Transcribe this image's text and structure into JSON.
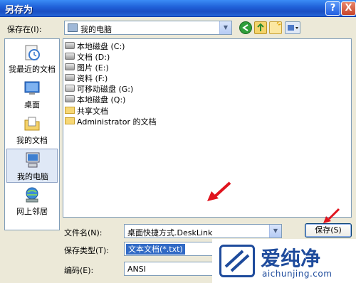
{
  "window": {
    "title": "另存为",
    "help_label": "?",
    "close_label": "X"
  },
  "lookin": {
    "label": "保存在(I):",
    "value": "我的电脑"
  },
  "places": [
    {
      "label": "我最近的文档",
      "icon": "recent-documents-icon"
    },
    {
      "label": "桌面",
      "icon": "desktop-icon"
    },
    {
      "label": "我的文档",
      "icon": "my-documents-icon"
    },
    {
      "label": "我的电脑",
      "icon": "my-computer-icon",
      "selected": true
    },
    {
      "label": "网上邻居",
      "icon": "network-places-icon"
    }
  ],
  "files": [
    {
      "label": "本地磁盘 (C:)",
      "icon": "drive-icon"
    },
    {
      "label": "文档 (D:)",
      "icon": "drive-icon"
    },
    {
      "label": "图片 (E:)",
      "icon": "drive-icon"
    },
    {
      "label": "资料 (F:)",
      "icon": "drive-icon"
    },
    {
      "label": "可移动磁盘 (G:)",
      "icon": "removable-drive-icon"
    },
    {
      "label": "本地磁盘 (Q:)",
      "icon": "drive-icon"
    },
    {
      "label": "共享文档",
      "icon": "folder-icon"
    },
    {
      "label": "Administrator 的文档",
      "icon": "folder-icon"
    }
  ],
  "form": {
    "filename_label": "文件名(N):",
    "filename_value": "桌面快捷方式.DeskLink",
    "filetype_label": "保存类型(T):",
    "filetype_value": "文本文档(*.txt)",
    "encoding_label": "编码(E):",
    "encoding_value": "ANSI",
    "save_label": "保存(S)"
  },
  "watermark": {
    "big_text": "爱纯净",
    "small_text": "aichunjing.com"
  },
  "colors": {
    "titlebar": "#1f5fd7",
    "selection": "#316ac5",
    "annotation_arrow": "#e0141e"
  }
}
